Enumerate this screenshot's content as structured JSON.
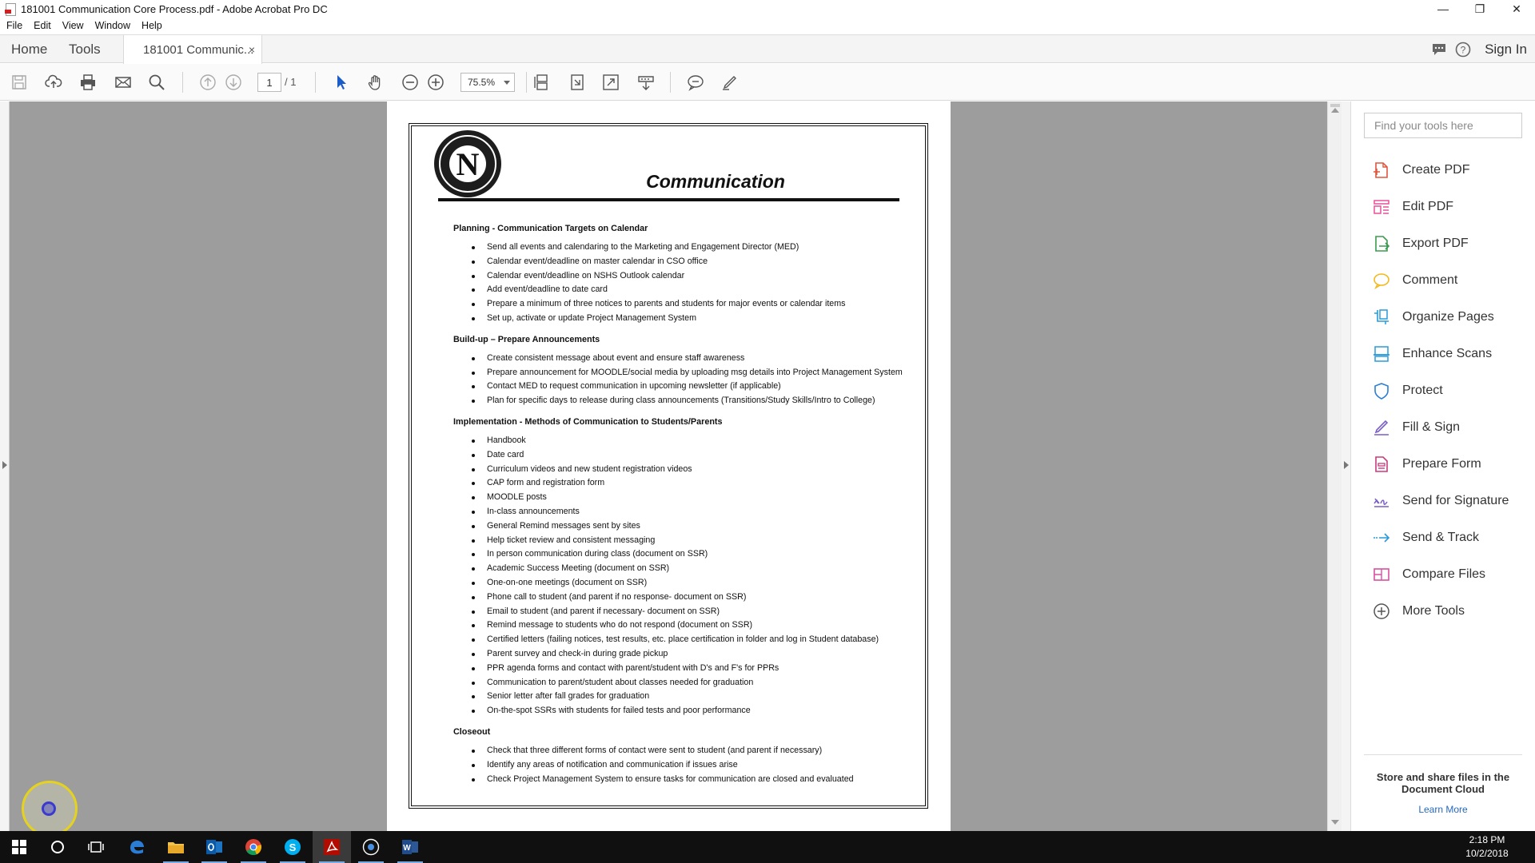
{
  "window": {
    "title": "181001 Communication Core Process.pdf - Adobe Acrobat Pro DC",
    "minimize": "—",
    "restore": "❐",
    "close": "✕"
  },
  "menu": [
    "File",
    "Edit",
    "View",
    "Window",
    "Help"
  ],
  "tabs": {
    "home": "Home",
    "tools": "Tools",
    "document": "181001 Communic...",
    "close": "×",
    "sign_in": "Sign In"
  },
  "toolbar": {
    "page_current": "1",
    "page_total": "/ 1",
    "zoom": "75.5%"
  },
  "document": {
    "seal_letter": "N",
    "title": "Communication",
    "sections": [
      {
        "heading": "Planning - Communication Targets on Calendar",
        "items": [
          "Send all events and calendaring to the Marketing and Engagement Director (MED)",
          "Calendar event/deadline on master calendar in CSO office",
          "Calendar event/deadline on NSHS Outlook calendar",
          "Add event/deadline to date card",
          "Prepare a minimum of three notices to parents and students for major events or calendar items",
          "Set up, activate or update Project Management System"
        ]
      },
      {
        "heading": "Build-up – Prepare Announcements",
        "items": [
          "Create consistent message about event and ensure staff awareness",
          "Prepare announcement for MOODLE/social media by uploading msg details into Project Management System",
          "Contact MED to request communication in upcoming newsletter (if applicable)",
          "Plan for specific days to release during class announcements (Transitions/Study Skills/Intro to College)"
        ]
      },
      {
        "heading": "Implementation - Methods of Communication to Students/Parents",
        "items": [
          "Handbook",
          "Date card",
          "Curriculum videos and new student registration videos",
          "CAP form and registration form",
          "MOODLE posts",
          "In-class announcements",
          "General Remind messages sent by sites",
          "Help ticket review and consistent messaging",
          "In person communication during class (document on SSR)",
          "Academic Success Meeting (document on SSR)",
          "One-on-one meetings (document on SSR)",
          "Phone call to student (and parent if no response- document on SSR)",
          "Email to student (and parent if necessary- document on SSR)",
          "Remind message to students who do not respond (document on SSR)",
          "Certified letters (failing notices, test results, etc. place certification in folder and log in Student database)",
          "Parent survey and check-in during grade pickup",
          "PPR agenda forms and contact with parent/student with D's and F's for PPRs",
          "Communication to parent/student about classes needed for graduation",
          "Senior letter after fall grades for graduation",
          "On-the-spot SSRs with students for failed tests and poor performance"
        ]
      },
      {
        "heading": "Closeout",
        "items": [
          "Check that three different forms of contact were sent to student (and parent if necessary)",
          "Identify any areas of notification and communication if issues arise",
          "Check Project Management System to ensure tasks for communication are closed and evaluated"
        ]
      }
    ]
  },
  "tools_pane": {
    "search_placeholder": "Find your tools here",
    "items": [
      {
        "label": "Create PDF",
        "icon": "create-pdf-icon",
        "color": "#e0573f"
      },
      {
        "label": "Edit PDF",
        "icon": "edit-pdf-icon",
        "color": "#e8509a"
      },
      {
        "label": "Export PDF",
        "icon": "export-pdf-icon",
        "color": "#3a9b4e"
      },
      {
        "label": "Comment",
        "icon": "comment-icon",
        "color": "#f3b91d"
      },
      {
        "label": "Organize Pages",
        "icon": "organize-pages-icon",
        "color": "#2a9bd7"
      },
      {
        "label": "Enhance Scans",
        "icon": "enhance-scans-icon",
        "color": "#2a9bd7"
      },
      {
        "label": "Protect",
        "icon": "protect-icon",
        "color": "#2a7fd2"
      },
      {
        "label": "Fill & Sign",
        "icon": "fill-sign-icon",
        "color": "#7b5ec6"
      },
      {
        "label": "Prepare Form",
        "icon": "prepare-form-icon",
        "color": "#c83b7d"
      },
      {
        "label": "Send for Signature",
        "icon": "send-signature-icon",
        "color": "#7b5ec6"
      },
      {
        "label": "Send & Track",
        "icon": "send-track-icon",
        "color": "#2a9bd7"
      },
      {
        "label": "Compare Files",
        "icon": "compare-files-icon",
        "color": "#d9509e"
      },
      {
        "label": "More Tools",
        "icon": "more-tools-icon",
        "color": "#555555"
      }
    ],
    "cloud_text": "Store and share files in the Document Cloud",
    "learn_more": "Learn More"
  },
  "taskbar": {
    "time": "2:18 PM",
    "date": "10/2/2018"
  }
}
